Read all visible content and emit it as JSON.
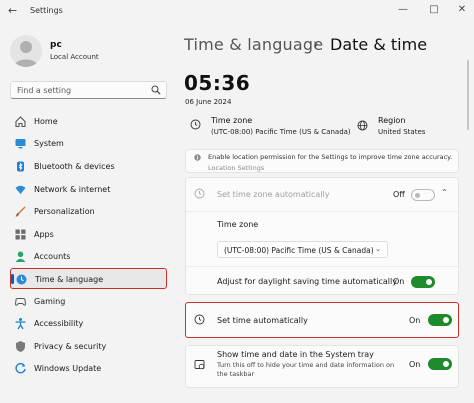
{
  "window": {
    "title": "Settings",
    "controls": [
      "minimize-icon",
      "maximize-icon",
      "close-icon"
    ]
  },
  "account": {
    "name": "pc",
    "type": "Local Account"
  },
  "search": {
    "placeholder": "Find a setting"
  },
  "sidebar": {
    "items": [
      {
        "label": "Home",
        "icon": "home-icon"
      },
      {
        "label": "System",
        "icon": "system-icon"
      },
      {
        "label": "Bluetooth & devices",
        "icon": "bluetooth-icon"
      },
      {
        "label": "Network & internet",
        "icon": "network-icon"
      },
      {
        "label": "Personalization",
        "icon": "personalization-icon"
      },
      {
        "label": "Apps",
        "icon": "apps-icon"
      },
      {
        "label": "Accounts",
        "icon": "accounts-icon"
      },
      {
        "label": "Time & language",
        "icon": "time-language-icon",
        "active": true
      },
      {
        "label": "Gaming",
        "icon": "gaming-icon"
      },
      {
        "label": "Accessibility",
        "icon": "accessibility-icon"
      },
      {
        "label": "Privacy & security",
        "icon": "shield-icon"
      },
      {
        "label": "Windows Update",
        "icon": "windows-update-icon"
      }
    ]
  },
  "breadcrumb": {
    "parent": "Time & language",
    "separator": "›",
    "current": "Date & time"
  },
  "clock": {
    "time": "05:36",
    "date": "06 June 2024"
  },
  "timezone_info": {
    "title": "Time zone",
    "value": "(UTC-08:00) Pacific Time (US & Canada)"
  },
  "region_info": {
    "title": "Region",
    "value": "United States"
  },
  "location_notice": {
    "text": "Enable location permission for the Settings to improve time zone accuracy.",
    "link": "Location Settings"
  },
  "auto_timezone": {
    "label": "Set time zone automatically",
    "state_text": "Off",
    "enabled": false
  },
  "timezone_select": {
    "label": "Time zone",
    "selected": "(UTC-08:00) Pacific Time (US & Canada)"
  },
  "dst": {
    "label": "Adjust for daylight saving time automatically",
    "state_text": "On"
  },
  "auto_time": {
    "label": "Set time automatically",
    "state_text": "On"
  },
  "systray": {
    "label": "Show time and date in the System tray",
    "sub_line1": "Turn this off to hide your time and date information on",
    "sub_line2": "the taskbar",
    "state_text": "On"
  },
  "colors": {
    "accent": "#005fb8",
    "toggle_on": "#1f8a2b",
    "highlight_border": "#c9302c"
  }
}
